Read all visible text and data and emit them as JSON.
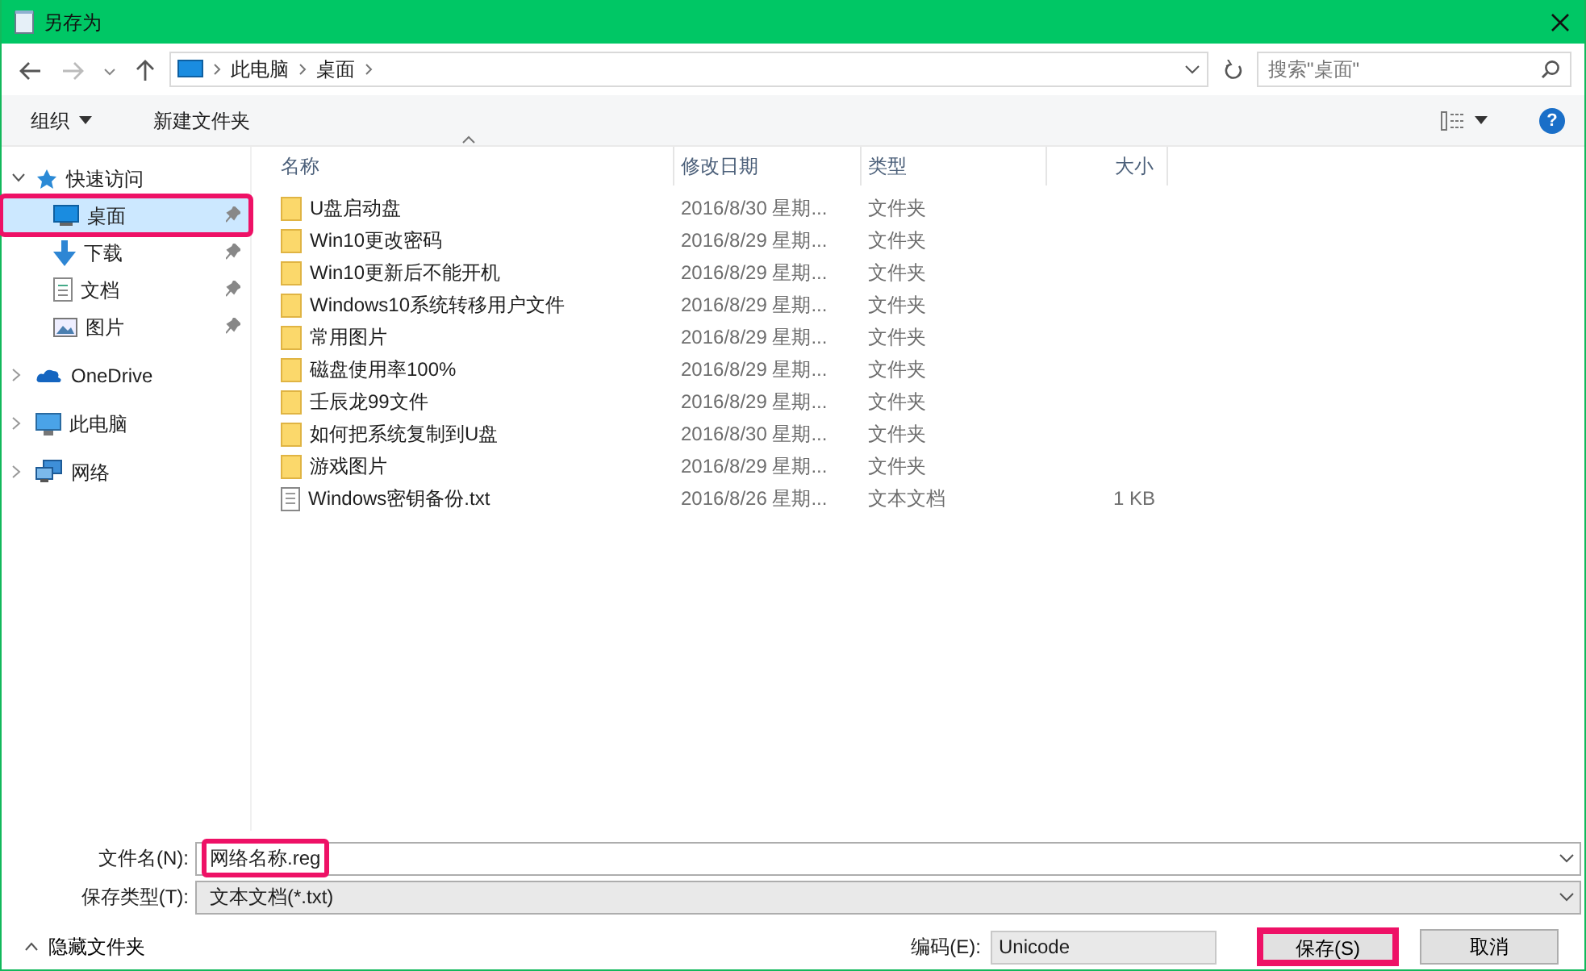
{
  "window": {
    "title": "另存为"
  },
  "nav": {
    "breadcrumb": [
      "此电脑",
      "桌面"
    ],
    "search_placeholder": "搜索\"桌面\""
  },
  "toolbar": {
    "organize": "组织",
    "new_folder": "新建文件夹",
    "help": "?"
  },
  "sidebar": {
    "items": [
      {
        "label": "快速访问",
        "kind": "star",
        "expanded": true,
        "children": [
          {
            "label": "桌面",
            "kind": "desktop",
            "selected": true,
            "highlighted": true,
            "pinned": true
          },
          {
            "label": "下载",
            "kind": "download",
            "selected": false,
            "highlighted": false,
            "pinned": true
          },
          {
            "label": "文档",
            "kind": "document",
            "selected": false,
            "highlighted": false,
            "pinned": true
          },
          {
            "label": "图片",
            "kind": "picture",
            "selected": false,
            "highlighted": false,
            "pinned": true
          }
        ]
      },
      {
        "label": "OneDrive",
        "kind": "cloud",
        "expanded": false
      },
      {
        "label": "此电脑",
        "kind": "computer",
        "expanded": false
      },
      {
        "label": "网络",
        "kind": "network",
        "expanded": false
      }
    ]
  },
  "table": {
    "columns": [
      {
        "label": "名称",
        "sorted": true
      },
      {
        "label": "修改日期",
        "sorted": false
      },
      {
        "label": "类型",
        "sorted": false
      },
      {
        "label": "大小",
        "sorted": false
      }
    ],
    "rows": [
      {
        "kind": "folder",
        "name": "U盘启动盘",
        "date": "2016/8/30 星期...",
        "type": "文件夹"
      },
      {
        "kind": "folder",
        "name": "Win10更改密码",
        "date": "2016/8/29 星期...",
        "type": "文件夹"
      },
      {
        "kind": "folder",
        "name": "Win10更新后不能开机",
        "date": "2016/8/29 星期...",
        "type": "文件夹"
      },
      {
        "kind": "folder",
        "name": "Windows10系统转移用户文件",
        "date": "2016/8/29 星期...",
        "type": "文件夹"
      },
      {
        "kind": "folder",
        "name": "常用图片",
        "date": "2016/8/29 星期...",
        "type": "文件夹"
      },
      {
        "kind": "folder",
        "name": "磁盘使用率100%",
        "date": "2016/8/29 星期...",
        "type": "文件夹"
      },
      {
        "kind": "folder",
        "name": "壬辰龙99文件",
        "date": "2016/8/29 星期...",
        "type": "文件夹"
      },
      {
        "kind": "folder",
        "name": "如何把系统复制到U盘",
        "date": "2016/8/30 星期...",
        "type": "文件夹"
      },
      {
        "kind": "folder",
        "name": "游戏图片",
        "date": "2016/8/29 星期...",
        "type": "文件夹"
      },
      {
        "kind": "text",
        "name": "Windows密钥备份.txt",
        "date": "2016/8/26 星期...",
        "type": "文本文档",
        "size": "1 KB"
      }
    ]
  },
  "fields": [
    {
      "label": "文件名(N):",
      "value": "网络名称.reg",
      "highlighted": true,
      "editable": true
    },
    {
      "label": "保存类型(T):",
      "value": "文本文档(*.txt)",
      "highlighted": false,
      "editable": false
    }
  ],
  "footer": {
    "hide_folders": "隐藏文件夹",
    "encoding_label": "编码(E):",
    "encoding_value": "Unicode",
    "buttons": [
      {
        "label": "保存(S)",
        "highlighted": true
      },
      {
        "label": "取消",
        "highlighted": false
      }
    ]
  }
}
